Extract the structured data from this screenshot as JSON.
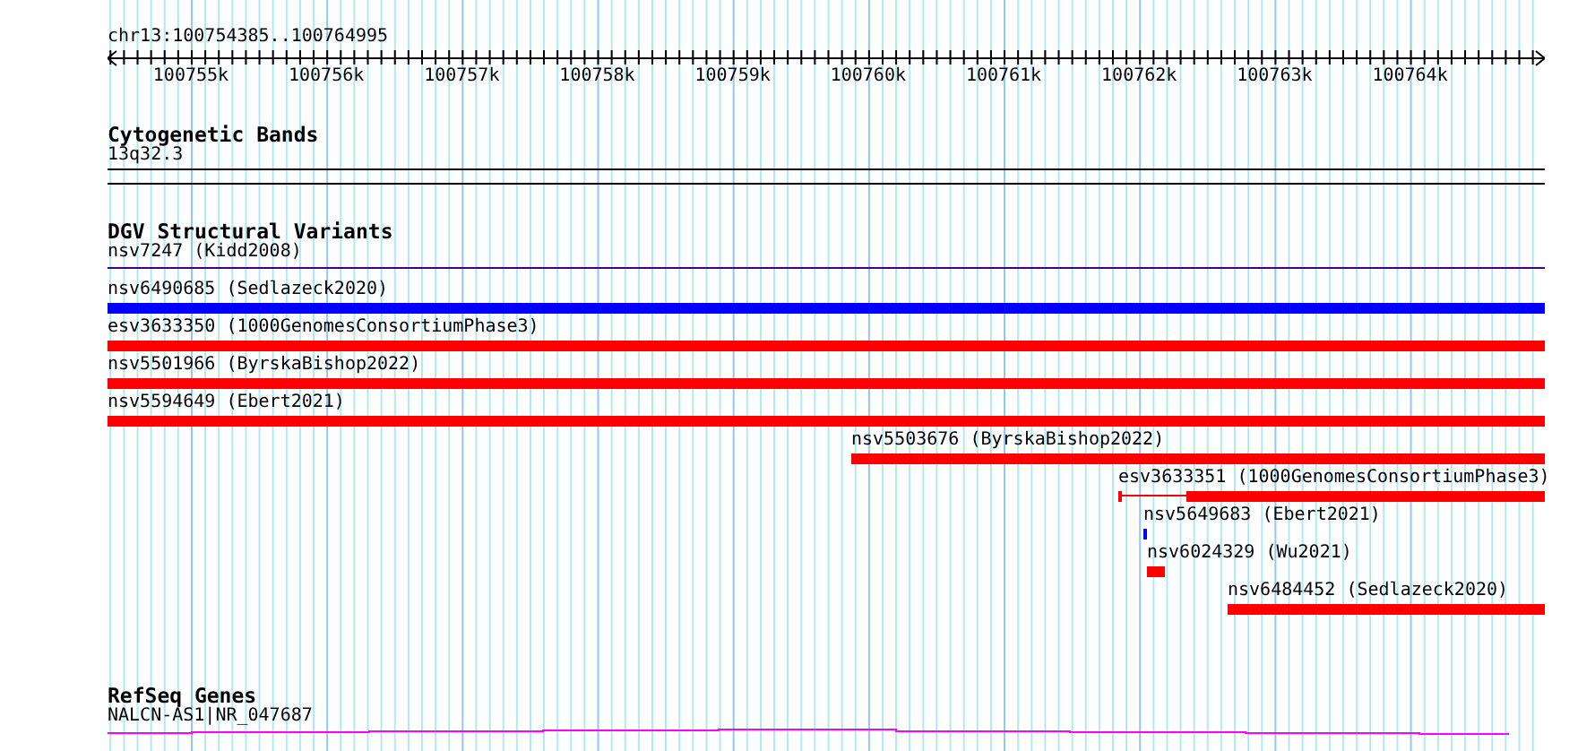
{
  "ruler": {
    "title": "chr13:100754385..100764995",
    "ticks": [
      "100755k",
      "100756k",
      "100757k",
      "100758k",
      "100759k",
      "100760k",
      "100761k",
      "100762k",
      "100763k",
      "100764k"
    ]
  },
  "tracks": [
    {
      "kind": "cytoband",
      "title": "Cytogenetic Bands",
      "items": [
        {
          "label": "13q32.3"
        }
      ]
    },
    {
      "kind": "variants",
      "title": "DGV Structural Variants",
      "items": [
        {
          "label": "nsv7247 (Kidd2008)",
          "kind": "line",
          "color": "#400080"
        },
        {
          "label": "nsv6490685 (Sedlazeck2020)",
          "kind": "block",
          "color": "#0000ff"
        },
        {
          "label": "esv3633350 (1000GenomesConsortiumPhase3)",
          "kind": "block",
          "color": "#ff0000"
        },
        {
          "label": "nsv5501966 (ByrskaBishop2022)",
          "kind": "block",
          "color": "#ff0000"
        },
        {
          "label": "nsv5594649 (Ebert2021)",
          "kind": "block",
          "color": "#ff0000"
        },
        {
          "label": "nsv5503676 (ByrskaBishop2022)",
          "kind": "block",
          "color": "#ff0000"
        },
        {
          "label": "esv3633351 (1000GenomesConsortiumPhase3)",
          "kind": "gapped",
          "color": "#ff0000"
        },
        {
          "label": "nsv5649683 (Ebert2021)",
          "kind": "block",
          "color": "#0000ff"
        },
        {
          "label": "nsv6024329 (Wu2021)",
          "kind": "block",
          "color": "#ff0000"
        },
        {
          "label": "nsv6484452 (Sedlazeck2020)",
          "kind": "block",
          "color": "#ff0000"
        }
      ]
    },
    {
      "kind": "genes",
      "title": "RefSeq Genes",
      "items": [
        {
          "label": "NALCN-AS1|NR_047687"
        }
      ]
    }
  ]
}
